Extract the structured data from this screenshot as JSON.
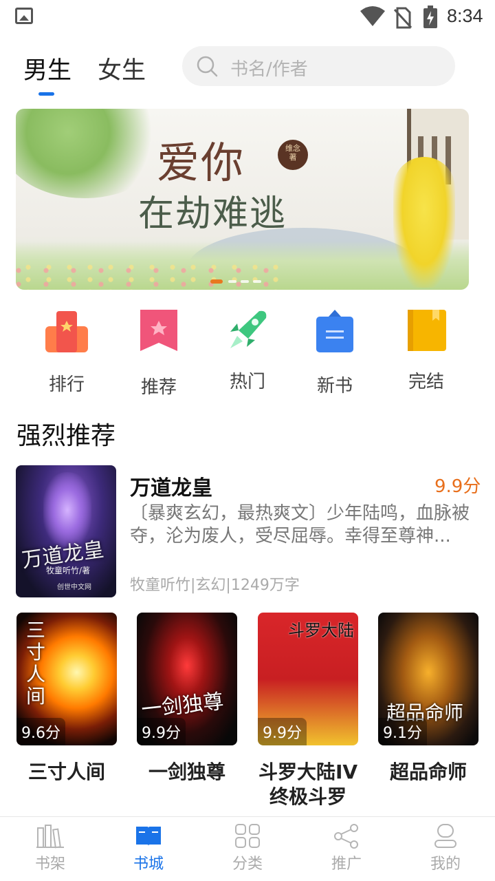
{
  "status_bar": {
    "time": "8:34",
    "icons": [
      "image-icon",
      "wifi-icon",
      "no-sim-icon",
      "battery-charging-icon"
    ]
  },
  "header": {
    "tabs": [
      {
        "label": "男生",
        "selected": true
      },
      {
        "label": "女生",
        "selected": false
      }
    ],
    "search": {
      "placeholder": "书名/作者",
      "icon": "search-icon"
    }
  },
  "banner": {
    "title_line1": "爱你",
    "title_line2": "在劫难逃",
    "seal": "维念\n著",
    "indicator_count": 4,
    "active_index": 0,
    "accent": "#e8781f"
  },
  "categories": [
    {
      "label": "排行",
      "icon": "ranking-icon",
      "color": "#f2554c"
    },
    {
      "label": "推荐",
      "icon": "recommend-bookmark-icon",
      "color": "#f0557a"
    },
    {
      "label": "热门",
      "icon": "rocket-icon",
      "color": "#3ec77f"
    },
    {
      "label": "新书",
      "icon": "new-book-bag-icon",
      "color": "#3b82f0"
    },
    {
      "label": "完结",
      "icon": "finished-book-icon",
      "color": "#f7b500"
    }
  ],
  "section": {
    "title": "强烈推荐"
  },
  "featured": {
    "title": "万道龙皇",
    "score": "9.9分",
    "description": "〔暴爽玄幻，最热爽文〕少年陆鸣，血脉被夺，沦为废人，受尽屈辱。幸得至尊神...",
    "meta": "牧童听竹|玄幻|1249万字",
    "cover_title": "万道龙皇",
    "cover_author": "牧童听竹/著",
    "cover_publisher": "创世中文网",
    "score_color": "#e86f1c"
  },
  "grid_books": [
    {
      "title": "三寸人间",
      "score": "9.6分",
      "cover_text": "三寸人间"
    },
    {
      "title": "一剑独尊",
      "score": "9.9分",
      "cover_text": "一剑独尊"
    },
    {
      "title": "斗罗大陆IV终极斗罗",
      "score": "9.9分",
      "cover_text": "斗罗大陆"
    },
    {
      "title": "超品命师",
      "score": "9.1分",
      "cover_text": "超品命师"
    }
  ],
  "bottom_nav": [
    {
      "label": "书架",
      "icon": "bookshelf-icon",
      "active": false
    },
    {
      "label": "书城",
      "icon": "bookstore-icon",
      "active": true
    },
    {
      "label": "分类",
      "icon": "category-grid-icon",
      "active": false
    },
    {
      "label": "推广",
      "icon": "share-icon",
      "active": false
    },
    {
      "label": "我的",
      "icon": "profile-icon",
      "active": false
    }
  ],
  "colors": {
    "primary": "#1a73e8",
    "inactive": "#aaaaaa"
  }
}
